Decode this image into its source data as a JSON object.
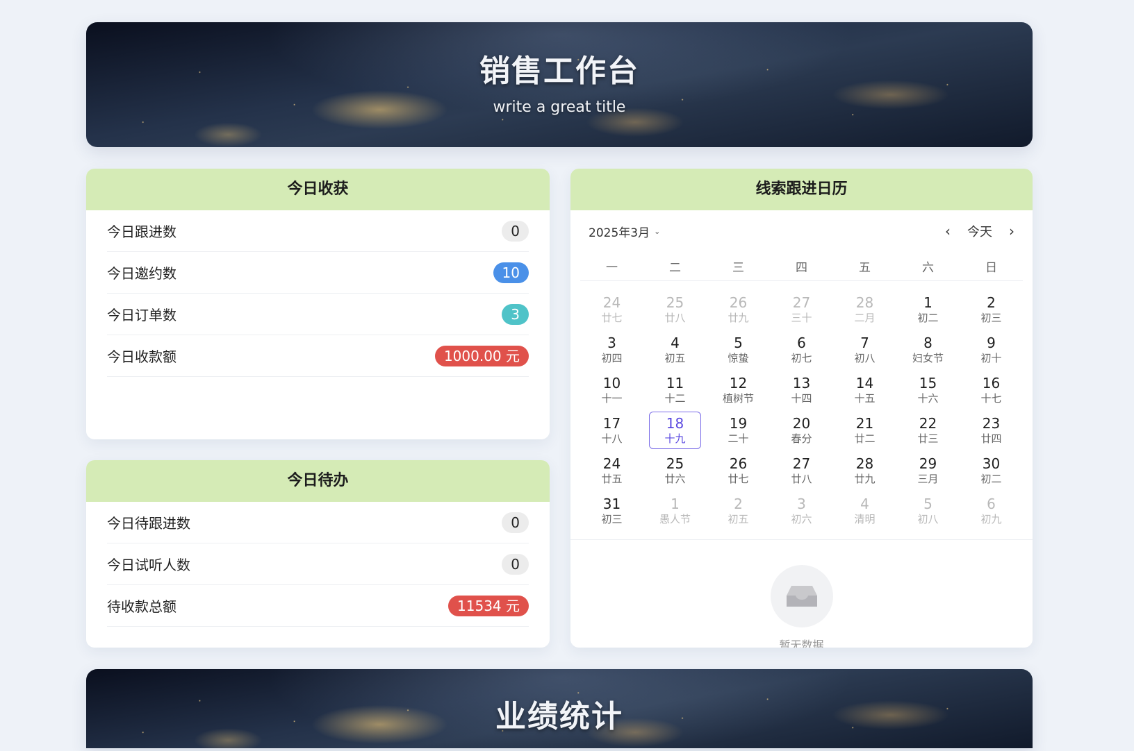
{
  "header": {
    "title": "销售工作台",
    "subtitle": "write a great title"
  },
  "harvest": {
    "title": "今日收获",
    "items": [
      {
        "label": "今日跟进数",
        "value": "0"
      },
      {
        "label": "今日邀约数",
        "value": "10"
      },
      {
        "label": "今日订单数",
        "value": "3"
      },
      {
        "label": "今日收款额",
        "value": "1000.00 元"
      }
    ]
  },
  "todo": {
    "title": "今日待办",
    "items": [
      {
        "label": "今日待跟进数",
        "value": "0"
      },
      {
        "label": "今日试听人数",
        "value": "0"
      },
      {
        "label": "待收款总额",
        "value": "11534 元"
      }
    ]
  },
  "calendar": {
    "title": "线索跟进日历",
    "month_label": "2025年3月",
    "today_label": "今天",
    "weekdays": [
      "一",
      "二",
      "三",
      "四",
      "五",
      "六",
      "日"
    ],
    "days": [
      {
        "d": "24",
        "l": "廿七",
        "out": true
      },
      {
        "d": "25",
        "l": "廿八",
        "out": true
      },
      {
        "d": "26",
        "l": "廿九",
        "out": true
      },
      {
        "d": "27",
        "l": "三十",
        "out": true
      },
      {
        "d": "28",
        "l": "二月",
        "out": true
      },
      {
        "d": "1",
        "l": "初二"
      },
      {
        "d": "2",
        "l": "初三"
      },
      {
        "d": "3",
        "l": "初四"
      },
      {
        "d": "4",
        "l": "初五"
      },
      {
        "d": "5",
        "l": "惊蛰"
      },
      {
        "d": "6",
        "l": "初七"
      },
      {
        "d": "7",
        "l": "初八"
      },
      {
        "d": "8",
        "l": "妇女节"
      },
      {
        "d": "9",
        "l": "初十"
      },
      {
        "d": "10",
        "l": "十一"
      },
      {
        "d": "11",
        "l": "十二"
      },
      {
        "d": "12",
        "l": "植树节"
      },
      {
        "d": "13",
        "l": "十四"
      },
      {
        "d": "14",
        "l": "十五"
      },
      {
        "d": "15",
        "l": "十六"
      },
      {
        "d": "16",
        "l": "十七"
      },
      {
        "d": "17",
        "l": "十八"
      },
      {
        "d": "18",
        "l": "十九",
        "today": true
      },
      {
        "d": "19",
        "l": "二十"
      },
      {
        "d": "20",
        "l": "春分"
      },
      {
        "d": "21",
        "l": "廿二"
      },
      {
        "d": "22",
        "l": "廿三"
      },
      {
        "d": "23",
        "l": "廿四"
      },
      {
        "d": "24",
        "l": "廿五"
      },
      {
        "d": "25",
        "l": "廿六"
      },
      {
        "d": "26",
        "l": "廿七"
      },
      {
        "d": "27",
        "l": "廿八"
      },
      {
        "d": "28",
        "l": "廿九"
      },
      {
        "d": "29",
        "l": "三月"
      },
      {
        "d": "30",
        "l": "初二"
      },
      {
        "d": "31",
        "l": "初三"
      },
      {
        "d": "1",
        "l": "愚人节",
        "out": true
      },
      {
        "d": "2",
        "l": "初五",
        "out": true
      },
      {
        "d": "3",
        "l": "初六",
        "out": true
      },
      {
        "d": "4",
        "l": "清明",
        "out": true
      },
      {
        "d": "5",
        "l": "初八",
        "out": true
      },
      {
        "d": "6",
        "l": "初九",
        "out": true
      }
    ],
    "empty_icon": "inbox-icon",
    "empty_text": "暂无数据"
  },
  "stats_banner": {
    "title": "业绩统计"
  },
  "colors": {
    "header_green": "#d5ebb6",
    "badge_blue": "#4a90e8",
    "badge_cyan": "#4fc3c8",
    "badge_red": "#e0514b",
    "today_purple": "#5a48e0"
  }
}
